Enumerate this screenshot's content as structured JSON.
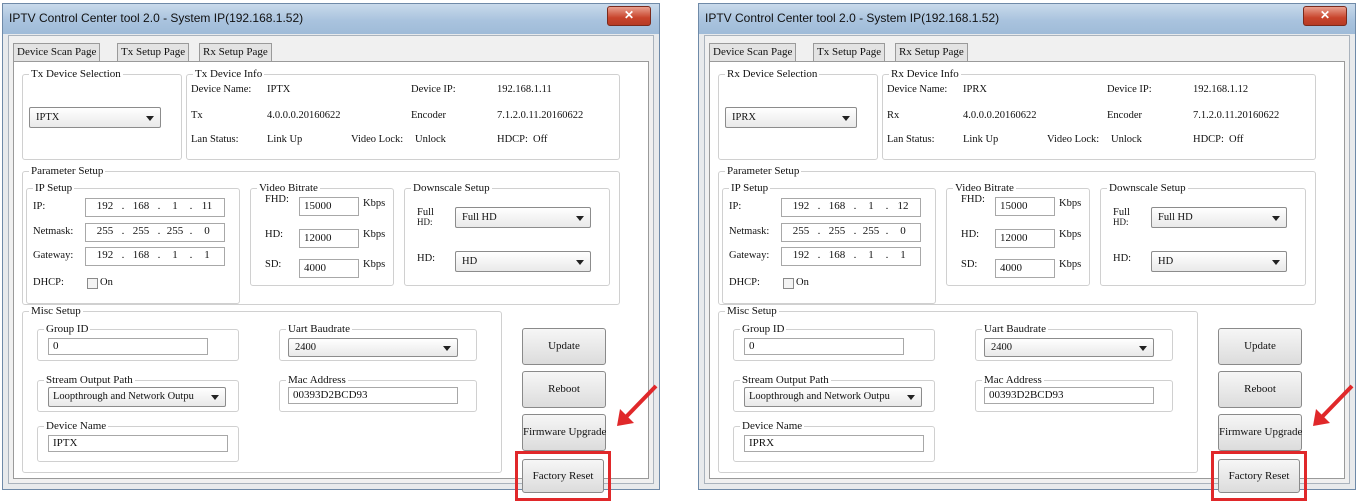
{
  "windows": [
    {
      "title": "IPTV Control Center tool 2.0 - System IP(192.168.1.52)",
      "close_icon": "close-icon",
      "tabs": [
        "Device Scan Page",
        "Tx Setup Page",
        "Rx Setup Page"
      ],
      "active_tab": "Tx Setup Page",
      "device_selection": {
        "legend": "Tx Device Selection",
        "value": "IPTX"
      },
      "device_info": {
        "legend": "Tx Device Info",
        "device_name_label": "Device Name:",
        "device_name": "IPTX",
        "device_ip_label": "Device IP:",
        "device_ip": "192.168.1.11",
        "fw_label": "Tx",
        "fw_version": "4.0.0.0.20160622",
        "encoder_label": "Encoder",
        "encoder_version": "7.1.2.0.11.20160622",
        "lan_label": "Lan Status:",
        "lan_value": "Link Up",
        "video_lock_label": "Video Lock:",
        "video_lock_value": "Unlock",
        "hdcp_label": "HDCP:",
        "hdcp_value": "Off"
      },
      "parameter_setup": {
        "legend": "Parameter Setup",
        "ip_setup": {
          "legend": "IP Setup",
          "ip_label": "IP:",
          "ip": [
            "192",
            "168",
            "1",
            "11"
          ],
          "netmask_label": "Netmask:",
          "netmask": [
            "255",
            "255",
            "255",
            "0"
          ],
          "gateway_label": "Gateway:",
          "gateway": [
            "192",
            "168",
            "1",
            "1"
          ],
          "dhcp_label": "DHCP:",
          "dhcp_on_label": "On"
        },
        "video_bitrate": {
          "legend": "Video Bitrate",
          "fhd_label": "FHD:",
          "fhd": "15000",
          "hd_label": "HD:",
          "hd": "12000",
          "sd_label": "SD:",
          "sd": "4000",
          "unit": "Kbps"
        },
        "downscale": {
          "legend": "Downscale Setup",
          "full_label_1": "Full",
          "full_label_2": "HD:",
          "full_value": "Full HD",
          "hd_label": "HD:",
          "hd_value": "HD"
        }
      },
      "misc_setup": {
        "legend": "Misc Setup",
        "group_id_legend": "Group ID",
        "group_id": "0",
        "uart_legend": "Uart Baudrate",
        "uart_value": "2400",
        "stream_legend": "Stream Output Path",
        "stream_value": "Loopthrough and Network Outpu",
        "mac_legend": "Mac Address",
        "mac_value": "00393D2BCD93",
        "device_name_legend": "Device Name",
        "device_name_value": "IPTX"
      },
      "buttons": {
        "update": "Update",
        "reboot": "Reboot",
        "firmware": "Firmware Upgrade",
        "factory_reset": "Factory Reset"
      }
    },
    {
      "title": "IPTV Control Center tool 2.0 - System IP(192.168.1.52)",
      "close_icon": "close-icon",
      "tabs": [
        "Device Scan Page",
        "Tx Setup Page",
        "Rx Setup Page"
      ],
      "active_tab": "Rx Setup Page",
      "device_selection": {
        "legend": "Rx Device Selection",
        "value": "IPRX"
      },
      "device_info": {
        "legend": "Rx Device Info",
        "device_name_label": "Device Name:",
        "device_name": "IPRX",
        "device_ip_label": "Device IP:",
        "device_ip": "192.168.1.12",
        "fw_label": "Rx",
        "fw_version": "4.0.0.0.20160622",
        "encoder_label": "Encoder",
        "encoder_version": "7.1.2.0.11.20160622",
        "lan_label": "Lan Status:",
        "lan_value": "Link Up",
        "video_lock_label": "Video Lock:",
        "video_lock_value": "Unlock",
        "hdcp_label": "HDCP:",
        "hdcp_value": "Off"
      },
      "parameter_setup": {
        "legend": "Parameter Setup",
        "ip_setup": {
          "legend": "IP Setup",
          "ip_label": "IP:",
          "ip": [
            "192",
            "168",
            "1",
            "12"
          ],
          "netmask_label": "Netmask:",
          "netmask": [
            "255",
            "255",
            "255",
            "0"
          ],
          "gateway_label": "Gateway:",
          "gateway": [
            "192",
            "168",
            "1",
            "1"
          ],
          "dhcp_label": "DHCP:",
          "dhcp_on_label": "On"
        },
        "video_bitrate": {
          "legend": "Video Bitrate",
          "fhd_label": "FHD:",
          "fhd": "15000",
          "hd_label": "HD:",
          "hd": "12000",
          "sd_label": "SD:",
          "sd": "4000",
          "unit": "Kbps"
        },
        "downscale": {
          "legend": "Downscale Setup",
          "full_label_1": "Full",
          "full_label_2": "HD:",
          "full_value": "Full HD",
          "hd_label": "HD:",
          "hd_value": "HD"
        }
      },
      "misc_setup": {
        "legend": "Misc Setup",
        "group_id_legend": "Group ID",
        "group_id": "0",
        "uart_legend": "Uart Baudrate",
        "uart_value": "2400",
        "stream_legend": "Stream Output Path",
        "stream_value": "Loopthrough and Network Outpu",
        "mac_legend": "Mac Address",
        "mac_value": "00393D2BCD93",
        "device_name_legend": "Device Name",
        "device_name_value": "IPRX"
      },
      "buttons": {
        "update": "Update",
        "reboot": "Reboot",
        "firmware": "Firmware Upgrade",
        "factory_reset": "Factory Reset"
      }
    }
  ],
  "annotation": {
    "highlight_color": "#e0282a",
    "target": "factory-reset-button"
  }
}
